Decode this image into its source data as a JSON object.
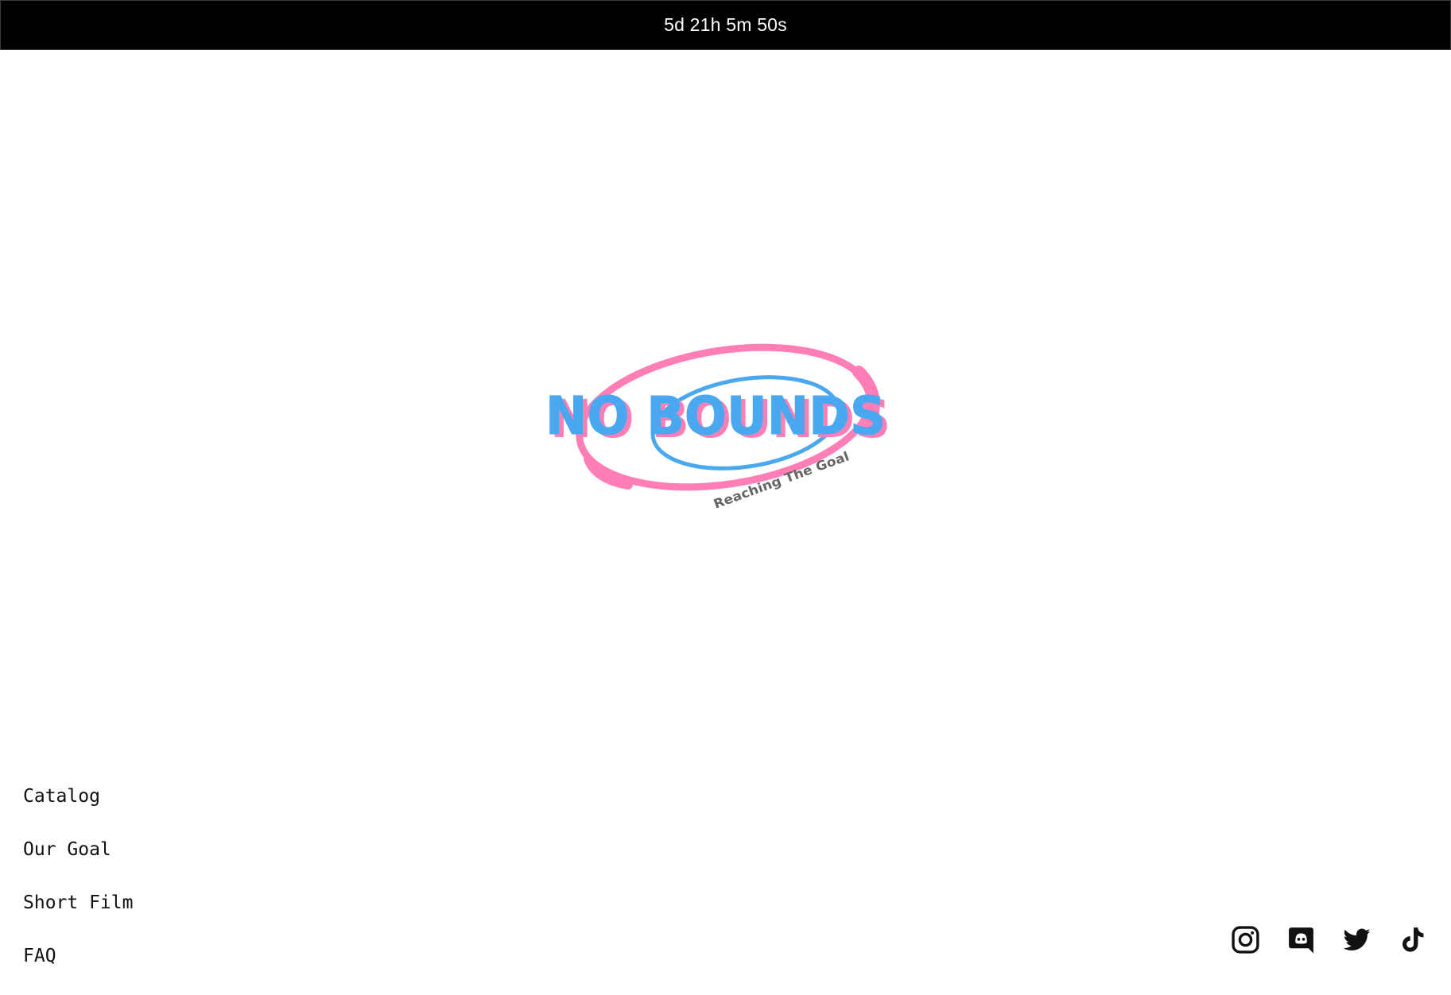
{
  "countdown": "5d 21h 5m 50s",
  "logo": {
    "wordmark": "NO BOUNDS",
    "tagline": "Reaching The Goal",
    "primary_color": "#4aa8f0",
    "accent_color": "#ff7eb6",
    "tagline_color": "#666666"
  },
  "nav": {
    "items": [
      {
        "label": "Catalog"
      },
      {
        "label": "Our Goal"
      },
      {
        "label": "Short Film"
      },
      {
        "label": "FAQ"
      }
    ]
  },
  "socials": [
    {
      "icon": "instagram-icon"
    },
    {
      "icon": "discord-icon"
    },
    {
      "icon": "twitter-icon"
    },
    {
      "icon": "tiktok-icon"
    }
  ]
}
